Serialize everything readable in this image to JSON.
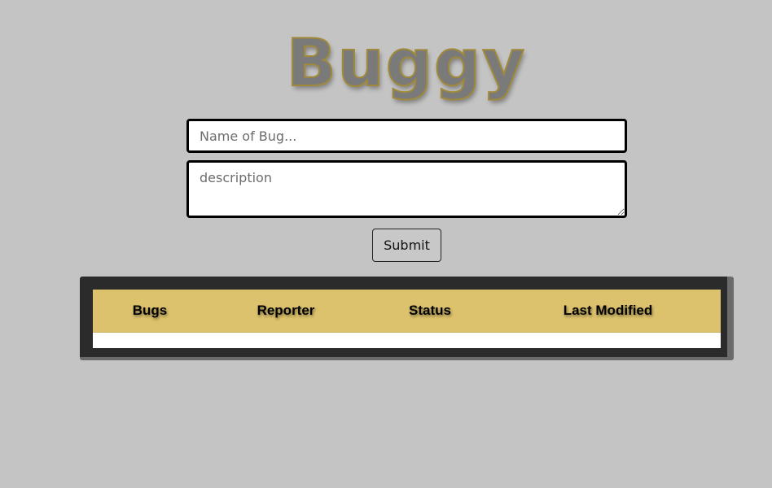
{
  "header": {
    "logo_text": "Buggy"
  },
  "form": {
    "name_placeholder": "Name of Bug...",
    "name_value": "",
    "description_placeholder": "description",
    "description_value": "",
    "submit_label": "Submit"
  },
  "table": {
    "columns": [
      "Bugs",
      "Reporter",
      "Status",
      "Last Modified"
    ],
    "rows": []
  },
  "colors": {
    "background": "#c4c4c4",
    "header_row": "#dcc26c",
    "frame": "#2b2b2b",
    "logo_fill": "#7a7a7a",
    "logo_outline": "#a08a3a"
  }
}
